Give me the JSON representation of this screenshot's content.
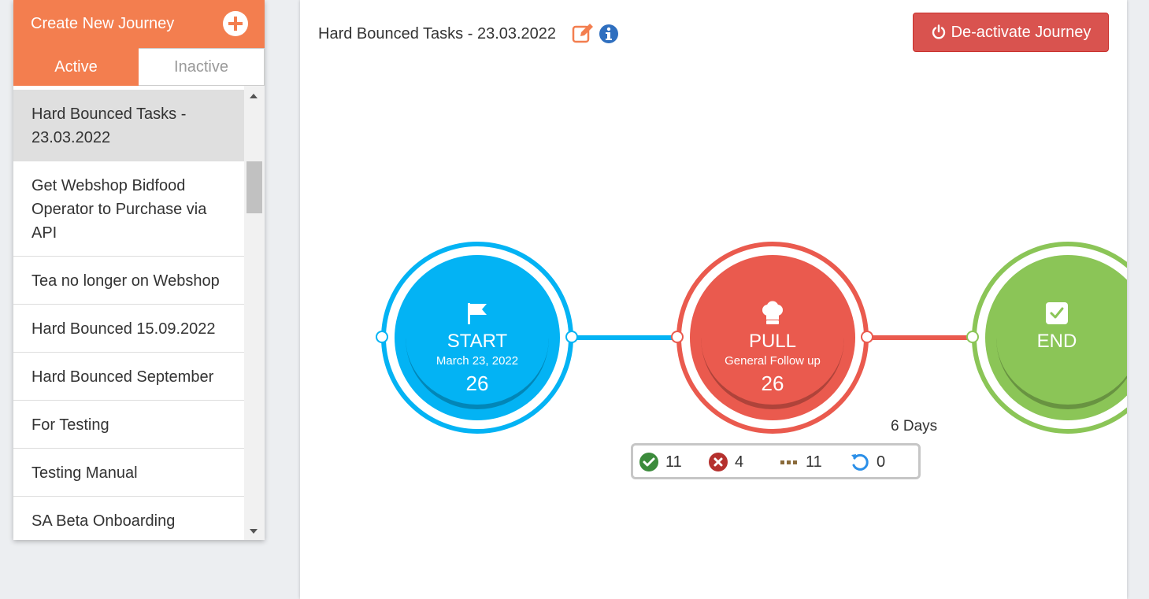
{
  "sidebar": {
    "create_label": "Create New Journey",
    "tabs": {
      "active": "Active",
      "inactive": "Inactive"
    },
    "items": [
      "Hard Bounced Tasks - 23.03.2022",
      "Get Webshop Bidfood Operator to Purchase via API",
      "Tea no longer on Webshop",
      "Hard Bounced 15.09.2022",
      "Hard Bounced September",
      "For Testing",
      "Testing Manual",
      "SA Beta Onboarding"
    ]
  },
  "main": {
    "title": "Hard Bounced Tasks - 23.03.2022",
    "deactivate_label": "De-activate Journey"
  },
  "flow": {
    "start": {
      "label": "START",
      "sub": "March 23, 2022",
      "count": "26",
      "color": "#03b3f4"
    },
    "pull": {
      "label": "PULL",
      "sub": "General Follow up",
      "count": "26",
      "color": "#ea5a4e"
    },
    "end": {
      "label": "END",
      "color": "#8bc557"
    },
    "days": "6 Days",
    "stats": {
      "completed": "11",
      "failed": "4",
      "pending": "11",
      "retry": "0"
    }
  },
  "colors": {
    "accent": "#f37e4f",
    "danger": "#d9534f",
    "start": "#03b3f4",
    "pull": "#ea5a4e",
    "end": "#8bc557"
  }
}
